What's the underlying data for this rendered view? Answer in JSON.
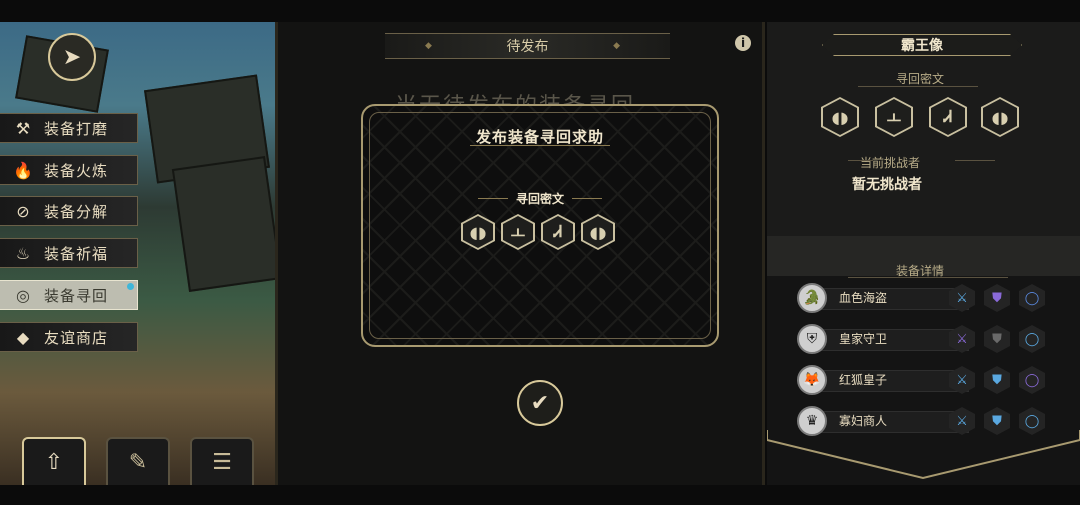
{
  "left_menu": {
    "items": [
      {
        "label": "装备打磨",
        "icon": "hammer-icon",
        "glyph": "⚒",
        "active": false
      },
      {
        "label": "装备火炼",
        "icon": "flame-icon",
        "glyph": "🔥",
        "active": false
      },
      {
        "label": "装备分解",
        "icon": "disassemble-icon",
        "glyph": "⊘",
        "active": false
      },
      {
        "label": "装备祈福",
        "icon": "bless-icon",
        "glyph": "♨",
        "active": false
      },
      {
        "label": "装备寻回",
        "icon": "retrieve-icon",
        "glyph": "◎",
        "active": true
      },
      {
        "label": "友谊商店",
        "icon": "fox-shop-icon",
        "glyph": "◆",
        "active": false
      }
    ]
  },
  "bottom_tabs": [
    {
      "icon": "upload-icon",
      "glyph": "⇧",
      "active": true
    },
    {
      "icon": "feather-icon",
      "glyph": "✎",
      "active": false
    },
    {
      "icon": "list-icon",
      "glyph": "☰",
      "active": false
    }
  ],
  "center": {
    "header": "待发布",
    "behind_text": "当无待发布的装备寻回"
  },
  "modal": {
    "title": "发布装备寻回求助",
    "section_label": "寻回密文",
    "runes": [
      "◖◗",
      "ㅗ",
      "Ꮧ",
      "◖◗"
    ]
  },
  "right_panel": {
    "title": "霸王像",
    "cipher_label": "寻回密文",
    "cipher_runes": [
      "◖◗",
      "ㅗ",
      "Ꮧ",
      "◖◗"
    ],
    "challenger_label": "当前挑战者",
    "challenger_value": "暂无挑战者",
    "equipment_label": "装备详情",
    "characters": [
      {
        "name": "血色海盗",
        "avatar": "croc",
        "equip_colors": [
          "#5aa8e0",
          "#8a6ad8",
          "#5a8ae0"
        ]
      },
      {
        "name": "皇家守卫",
        "avatar": "guard",
        "equip_colors": [
          "#8a6ad8",
          "#6a6a6a",
          "#5aa8e0"
        ]
      },
      {
        "name": "红狐皇子",
        "avatar": "fox",
        "equip_colors": [
          "#5aa8e0",
          "#5aa8e0",
          "#8a6ad8"
        ]
      },
      {
        "name": "寡妇商人",
        "avatar": "widow",
        "equip_colors": [
          "#5aa8e0",
          "#5aa8e0",
          "#5aa8e0"
        ]
      }
    ]
  }
}
